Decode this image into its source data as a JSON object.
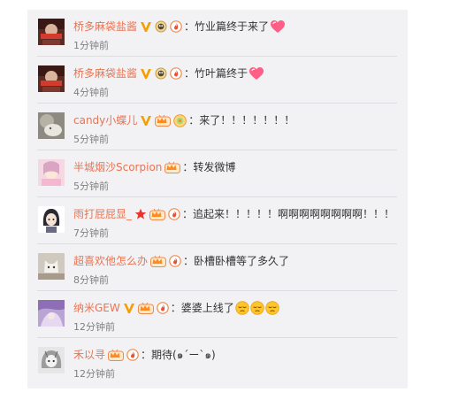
{
  "colors": {
    "username": "#eb7350",
    "text": "#333333",
    "time": "#808080",
    "panel_bg": "#f2f2f5",
    "separator": "#dcdde0"
  },
  "comments": [
    {
      "username": "桥多麻袋盐酱",
      "badges": [
        "vip-v",
        "bird-medal",
        "fire-badge"
      ],
      "colon": "：",
      "text": "竹业篇终于来了",
      "emojis": [
        "heart-emoji"
      ],
      "time": "1分钟前"
    },
    {
      "username": "桥多麻袋盐酱",
      "badges": [
        "vip-v",
        "bird-medal",
        "fire-badge"
      ],
      "colon": "：",
      "text": "竹叶篇终于",
      "emojis": [
        "heart-emoji"
      ],
      "time": "4分钟前"
    },
    {
      "username": "candy小蝶儿",
      "badges": [
        "vip-v",
        "crown-vip",
        "sun-medal"
      ],
      "colon": "：",
      "text": "来了！！！！！！！",
      "emojis": [],
      "time": "5分钟前"
    },
    {
      "username": "半城烟沙Scorpion",
      "badges": [
        "crown-vip"
      ],
      "colon": "：",
      "text": "转发微博",
      "emojis": [],
      "time": "5分钟前"
    },
    {
      "username": "雨打屁屁显_",
      "badges": [
        "red-star",
        "crown-vip",
        "fire-badge"
      ],
      "colon": "：",
      "text": "追起来！！！！！啊啊啊啊啊啊啊啊！！！",
      "emojis": [],
      "time": "7分钟前"
    },
    {
      "username": "超喜欢他怎么办",
      "badges": [
        "crown-vip",
        "fire-badge"
      ],
      "colon": "：",
      "text": "卧槽卧槽等了多久了",
      "emojis": [],
      "time": "8分钟前"
    },
    {
      "username": "纳米GEW",
      "badges": [
        "vip-v",
        "crown-vip",
        "fire-badge"
      ],
      "colon": "：",
      "text": "婆婆上线了",
      "emojis": [
        "sleepy-emoji",
        "sleepy-emoji",
        "sleepy-emoji"
      ],
      "time": "12分钟前"
    },
    {
      "username": "禾以寻",
      "badges": [
        "crown-vip",
        "fire-badge"
      ],
      "colon": "：",
      "text": "期待(๑´ー`๑)",
      "emojis": [],
      "time": "12分钟前"
    }
  ]
}
